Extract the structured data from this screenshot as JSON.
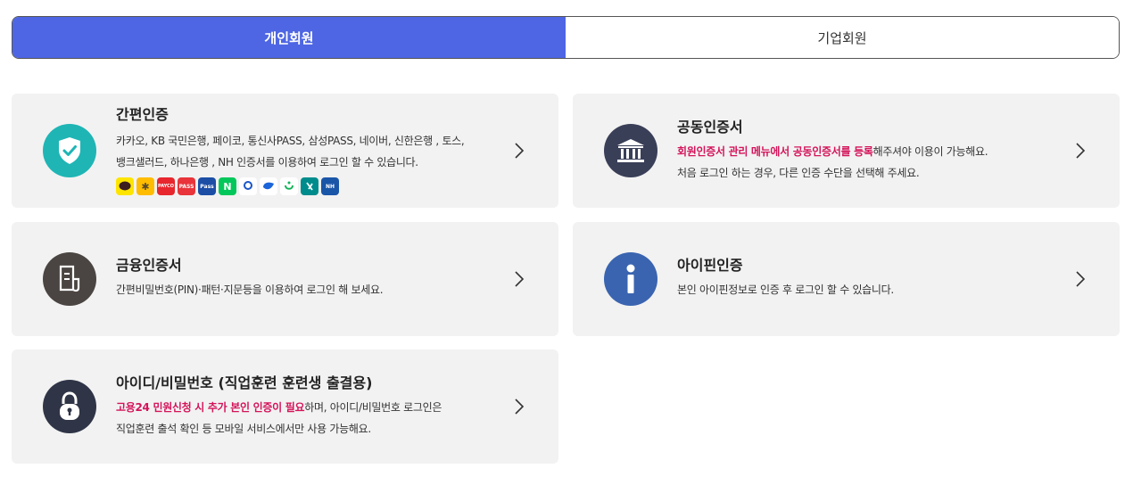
{
  "tabs": [
    {
      "label": "개인회원",
      "active": true
    },
    {
      "label": "기업회원",
      "active": false
    }
  ],
  "cards": {
    "simple": {
      "title": "간편인증",
      "desc_line1": "카카오, KB 국민은행, 페이코, 통신사PASS, 삼성PASS, 네이버, 신한은행 , 토스,",
      "desc_line2": "뱅크샐러드, 하나은행 , NH 인증서를 이용하여 로그인 할 수 있습니다.",
      "icon": "shield-check-icon",
      "color": "#1fb5b5",
      "providers": [
        {
          "icon": "kakao-icon",
          "color": "#fee500"
        },
        {
          "icon": "kb-icon",
          "color": "#ffbc00"
        },
        {
          "icon": "payco-icon",
          "color": "#e8262d",
          "text": "PAYCO"
        },
        {
          "icon": "pass-icon",
          "color": "#e8343a",
          "text": "PASS"
        },
        {
          "icon": "samsung-pass-icon",
          "color": "#1c4ea6",
          "text": "Pass"
        },
        {
          "icon": "naver-icon",
          "color": "#03c75a",
          "text": "N"
        },
        {
          "icon": "shinhan-icon",
          "color": "#ffffff"
        },
        {
          "icon": "toss-icon",
          "color": "#ffffff"
        },
        {
          "icon": "banksalad-icon",
          "color": "#ffffff"
        },
        {
          "icon": "hana-icon",
          "color": "#008c8c"
        },
        {
          "icon": "nh-icon",
          "color": "#1a56a8",
          "text": "NH"
        }
      ]
    },
    "joint": {
      "title": "공동인증서",
      "desc_hl": "회원인증서 관리 메뉴에서 공동인증서를 등록",
      "desc_rest": "해주셔야 이용이 가능해요.",
      "desc_line2": "처음 로그인 하는 경우, 다른 인증 수단을 선택해 주세요.",
      "icon": "bank-icon",
      "color": "#3a3f58"
    },
    "finance": {
      "title": "금융인증서",
      "desc_line1": "간편비밀번호(PIN)·패턴·지문등을 이용하여 로그인 해 보세요.",
      "icon": "certificate-icon",
      "color": "#4a4542"
    },
    "ipin": {
      "title": "아이핀인증",
      "desc_line1": "본인 아이핀정보로 인증 후 로그인 할 수 있습니다.",
      "icon": "info-icon",
      "color": "#3a64b0"
    },
    "idpw": {
      "title": "아이디/비밀번호 (직업훈련 훈련생 출결용)",
      "desc_hl": "고용24 민원신청 시 추가 본인 인증이 필요",
      "desc_rest": "하며, 아이디/비밀번호 로그인은",
      "desc_line2": "직업훈련 출석 확인 등 모바일 서비스에서만 사용 가능해요.",
      "icon": "lock-icon",
      "color": "#2f3547"
    }
  }
}
